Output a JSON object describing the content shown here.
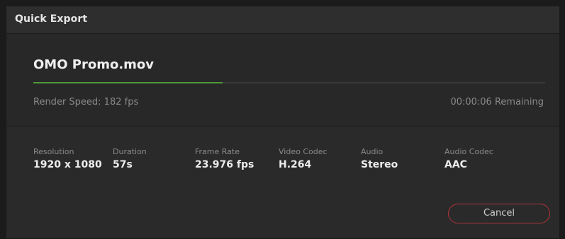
{
  "dialog": {
    "title": "Quick Export"
  },
  "render": {
    "filename": "OMO Promo.mov",
    "progress_fraction": 0.37,
    "speed": "Render Speed: 182 fps",
    "remaining": "00:00:06 Remaining"
  },
  "info": [
    {
      "label": "Resolution",
      "value": "1920 x 1080"
    },
    {
      "label": "Duration",
      "value": "57s"
    },
    {
      "label": "Frame Rate",
      "value": "23.976 fps"
    },
    {
      "label": "Video Codec",
      "value": "H.264"
    },
    {
      "label": "Audio",
      "value": "Stereo"
    },
    {
      "label": "Audio Codec",
      "value": "AAC"
    }
  ],
  "actions": {
    "cancel_label": "Cancel"
  },
  "colors": {
    "progress": "#4e9a36",
    "cancel_border": "#b0343a"
  }
}
